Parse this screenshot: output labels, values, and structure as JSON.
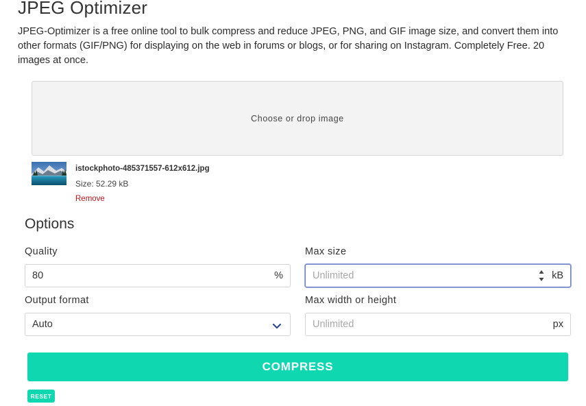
{
  "header": {
    "title": "JPEG Optimizer",
    "description": "JPEG-Optimizer is a free online tool to bulk compress and reduce JPEG, PNG, and GIF image size, and convert them into other formats (GIF/PNG) for displaying on the web in forums or blogs, or for sharing on Instagram. Completely Free. 20 images at once."
  },
  "dropzone": {
    "label": "Choose or drop image"
  },
  "file": {
    "name": "istockphoto-485371557-612x612.jpg",
    "size": "Size: 52.29 kB",
    "remove_label": "Remove",
    "thumbnail_icon": "landscape-thumbnail"
  },
  "options": {
    "title": "Options",
    "quality": {
      "label": "Quality",
      "value": "80",
      "unit": "%"
    },
    "max_size": {
      "label": "Max size",
      "placeholder": "Unlimited",
      "value": "",
      "unit": "kB"
    },
    "output_format": {
      "label": "Output format",
      "selected": "Auto"
    },
    "max_dimension": {
      "label": "Max width or height",
      "placeholder": "Unlimited",
      "value": "",
      "unit": "px"
    }
  },
  "actions": {
    "compress_label": "COMPRESS",
    "reset_label": "RESET"
  },
  "colors": {
    "accent": "#0fd8b1",
    "remove": "#c0141b",
    "focus_border": "#6c80c8",
    "chevron": "#2f4a8a"
  }
}
